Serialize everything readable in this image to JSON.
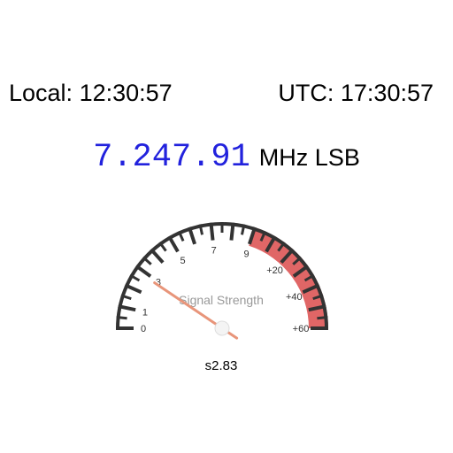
{
  "clock": {
    "local_label": "Local:",
    "local_time": "12:30:57",
    "utc_label": "UTC:",
    "utc_time": "17:30:57"
  },
  "frequency": {
    "value": "7.247.91",
    "unit": "MHz",
    "mode": "LSB",
    "value_color": "#2222dd"
  },
  "gauge": {
    "title": "Signal Strength",
    "reading": "s2.83",
    "s_value": 2.83,
    "labels": [
      {
        "text": "0",
        "pos": 0
      },
      {
        "text": "1",
        "pos": 1
      },
      {
        "text": "3",
        "pos": 3
      },
      {
        "text": "5",
        "pos": 5
      },
      {
        "text": "7",
        "pos": 7
      },
      {
        "text": "9",
        "pos": 9
      },
      {
        "text": "+20",
        "pos": 11
      },
      {
        "text": "+40",
        "pos": 13
      },
      {
        "text": "+60",
        "pos": 15
      }
    ],
    "scale_max": 15,
    "red_zone_start": 9,
    "colors": {
      "arc": "#333333",
      "red_zone": "#e06666",
      "needle": "#e8957a",
      "title": "#999999"
    }
  }
}
